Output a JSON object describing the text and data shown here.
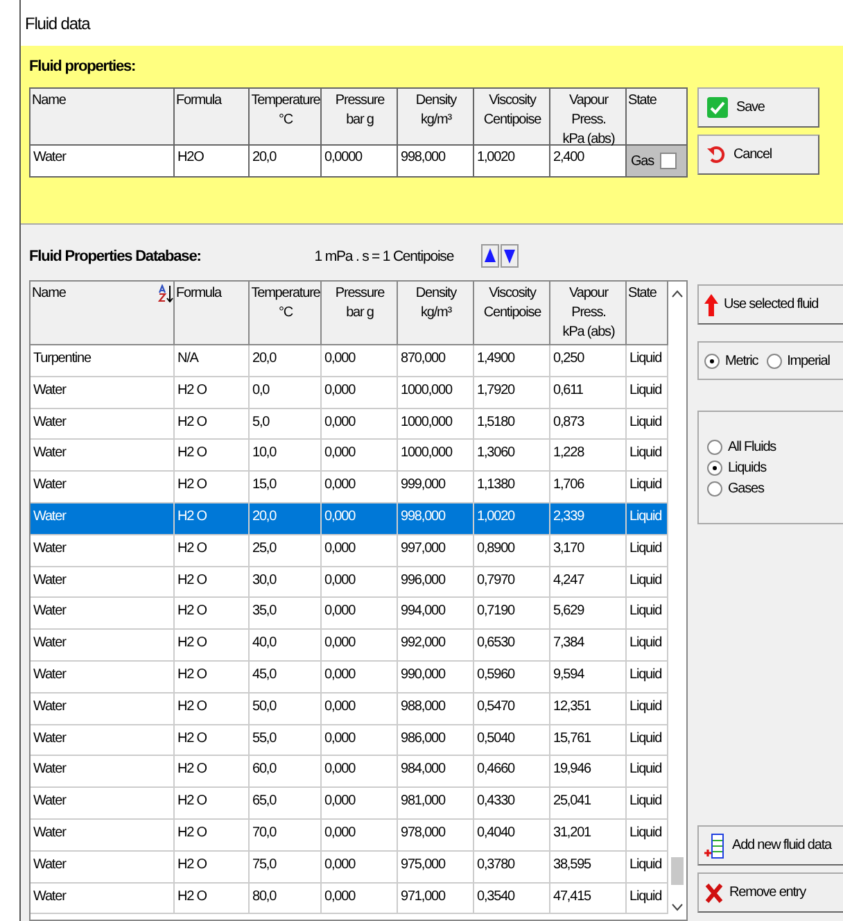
{
  "window": {
    "title": "Fluid data"
  },
  "fluid_properties": {
    "title": "Fluid properties:",
    "columns": [
      "Name",
      "Formula",
      "Temperature\n°C",
      "Pressure\nbar g",
      "Density\nkg/m³",
      "Viscosity\nCentipoise",
      "Vapour Press.\nkPa (abs)",
      "State"
    ],
    "row": [
      "Water",
      "H2O",
      "20,0",
      "0,0000",
      "998,000",
      "1,0020",
      "2,400"
    ],
    "state": {
      "label": "Gas",
      "checked": false
    },
    "buttons": [
      {
        "label": "Save",
        "kind": "save"
      },
      {
        "label": "Cancel",
        "kind": "cancel"
      }
    ]
  },
  "database": {
    "title": "Fluid Properties Database:",
    "note": "1 mPa . s = 1 Centipoise",
    "columns": [
      "Name",
      "Formula",
      "Temperature\n°C",
      "Pressure\nbar g",
      "Density\nkg/m³",
      "Viscosity\nCentipoise",
      "Vapour Press.\nkPa (abs)",
      "State"
    ],
    "rows": [
      {
        "cells": [
          "Turpentine",
          "N/A",
          "20,0",
          "0,000",
          "870,000",
          "1,4900",
          "0,250",
          "Liquid"
        ],
        "selected": false
      },
      {
        "cells": [
          "Water",
          "H2 O",
          "0,0",
          "0,000",
          "1000,000",
          "1,7920",
          "0,611",
          "Liquid"
        ],
        "selected": false
      },
      {
        "cells": [
          "Water",
          "H2 O",
          "5,0",
          "0,000",
          "1000,000",
          "1,5180",
          "0,873",
          "Liquid"
        ],
        "selected": false
      },
      {
        "cells": [
          "Water",
          "H2 O",
          "10,0",
          "0,000",
          "1000,000",
          "1,3060",
          "1,228",
          "Liquid"
        ],
        "selected": false
      },
      {
        "cells": [
          "Water",
          "H2 O",
          "15,0",
          "0,000",
          "999,000",
          "1,1380",
          "1,706",
          "Liquid"
        ],
        "selected": false
      },
      {
        "cells": [
          "Water",
          "H2 O",
          "20,0",
          "0,000",
          "998,000",
          "1,0020",
          "2,339",
          "Liquid"
        ],
        "selected": true
      },
      {
        "cells": [
          "Water",
          "H2 O",
          "25,0",
          "0,000",
          "997,000",
          "0,8900",
          "3,170",
          "Liquid"
        ],
        "selected": false
      },
      {
        "cells": [
          "Water",
          "H2 O",
          "30,0",
          "0,000",
          "996,000",
          "0,7970",
          "4,247",
          "Liquid"
        ],
        "selected": false
      },
      {
        "cells": [
          "Water",
          "H2 O",
          "35,0",
          "0,000",
          "994,000",
          "0,7190",
          "5,629",
          "Liquid"
        ],
        "selected": false
      },
      {
        "cells": [
          "Water",
          "H2 O",
          "40,0",
          "0,000",
          "992,000",
          "0,6530",
          "7,384",
          "Liquid"
        ],
        "selected": false
      },
      {
        "cells": [
          "Water",
          "H2 O",
          "45,0",
          "0,000",
          "990,000",
          "0,5960",
          "9,594",
          "Liquid"
        ],
        "selected": false
      },
      {
        "cells": [
          "Water",
          "H2 O",
          "50,0",
          "0,000",
          "988,000",
          "0,5470",
          "12,351",
          "Liquid"
        ],
        "selected": false
      },
      {
        "cells": [
          "Water",
          "H2 O",
          "55,0",
          "0,000",
          "986,000",
          "0,5040",
          "15,761",
          "Liquid"
        ],
        "selected": false
      },
      {
        "cells": [
          "Water",
          "H2 O",
          "60,0",
          "0,000",
          "984,000",
          "0,4660",
          "19,946",
          "Liquid"
        ],
        "selected": false
      },
      {
        "cells": [
          "Water",
          "H2 O",
          "65,0",
          "0,000",
          "981,000",
          "0,4330",
          "25,041",
          "Liquid"
        ],
        "selected": false
      },
      {
        "cells": [
          "Water",
          "H2 O",
          "70,0",
          "0,000",
          "978,000",
          "0,4040",
          "31,201",
          "Liquid"
        ],
        "selected": false
      },
      {
        "cells": [
          "Water",
          "H2 O",
          "75,0",
          "0,000",
          "975,000",
          "0,3780",
          "38,595",
          "Liquid"
        ],
        "selected": false
      },
      {
        "cells": [
          "Water",
          "H2 O",
          "80,0",
          "0,000",
          "971,000",
          "0,3540",
          "47,415",
          "Liquid"
        ],
        "selected": false
      }
    ],
    "use_button": {
      "label": "Use selected fluid"
    },
    "units": [
      {
        "label": "Metric",
        "selected": true
      },
      {
        "label": "Imperial",
        "selected": false
      }
    ],
    "filters": [
      {
        "label": "All Fluids",
        "selected": false
      },
      {
        "label": "Liquids",
        "selected": true
      },
      {
        "label": "Gases",
        "selected": false
      }
    ],
    "buttons": [
      {
        "label": "Add new fluid data",
        "kind": "add"
      },
      {
        "label": "Remove entry",
        "kind": "remove"
      }
    ]
  }
}
